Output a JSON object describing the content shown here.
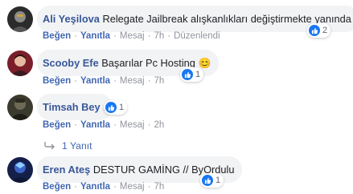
{
  "comments": [
    {
      "author": "Ali Yeşilova",
      "text": "Relegate Jailbreak alışkanlıkları değiştirmekte yanında",
      "reaction_count": "2",
      "actions": {
        "like": "Beğen",
        "reply": "Yanıtla",
        "message": "Mesaj",
        "time": "7h",
        "edited": "Düzenlendi"
      }
    },
    {
      "author": "Scooby Efe",
      "text": "Başarılar Pc Hosting 😊",
      "reaction_count": "1",
      "actions": {
        "like": "Beğen",
        "reply": "Yanıtla",
        "message": "Mesaj",
        "time": "7h"
      }
    },
    {
      "author": "Timsah Bey",
      "text": ".",
      "reaction_count": "1",
      "actions": {
        "like": "Beğen",
        "reply": "Yanıtla",
        "message": "Mesaj",
        "time": "2h"
      },
      "replies_label": "1 Yanıt"
    },
    {
      "author": "Eren Ateş",
      "text": "DESTUR GAMİNG // ByOrdulu",
      "reaction_count": "1",
      "actions": {
        "like": "Beğen",
        "reply": "Yanıtla",
        "message": "Mesaj",
        "time": "7h"
      }
    }
  ],
  "separator": "·",
  "colors": {
    "author": "#385898",
    "link": "#4267b2",
    "bubble": "#f2f3f5",
    "like_blue": "#1877f2",
    "meta": "#90949c"
  }
}
